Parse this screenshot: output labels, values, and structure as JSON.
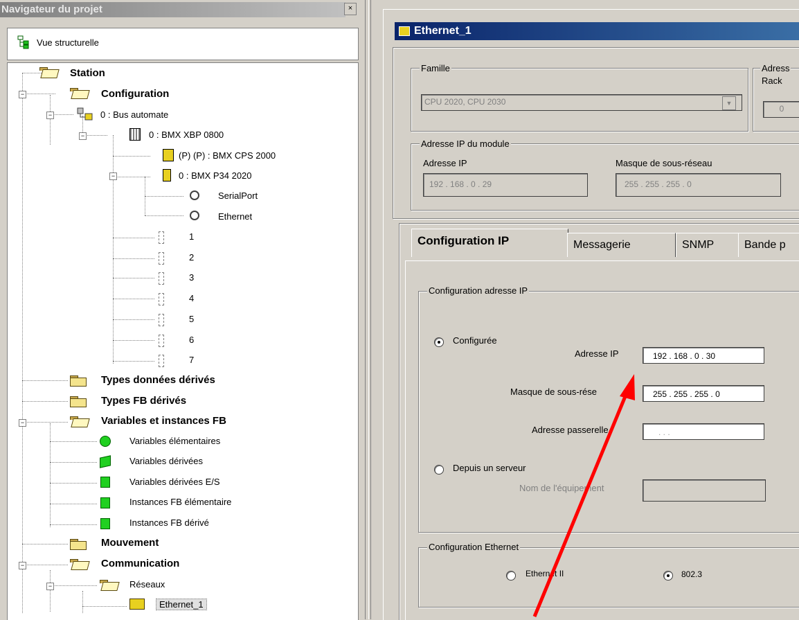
{
  "navigator": {
    "title": "Navigateur du projet",
    "close_glyph": "×",
    "view_label": "Vue structurelle",
    "tree": {
      "station": "Station",
      "configuration": "Configuration",
      "bus": "0 : Bus automate",
      "rack": "0 : BMX XBP 0800",
      "power": "(P) (P) : BMX CPS 2000",
      "cpu": "0 : BMX P34 2020",
      "serial": "SerialPort",
      "ethernet": "Ethernet",
      "slots": [
        "1",
        "2",
        "3",
        "4",
        "5",
        "6",
        "7"
      ],
      "types_donnees": "Types données dérivés",
      "types_fb": "Types FB dérivés",
      "variables_fb": "Variables et instances FB",
      "var_elem": "Variables élémentaires",
      "var_derivees": "Variables dérivées",
      "var_derivees_es": "Variables dérivées E/S",
      "inst_fb_elem": "Instances FB élémentaire",
      "inst_fb_derive": "Instances FB dérivé",
      "mouvement": "Mouvement",
      "communication": "Communication",
      "reseaux": "Réseaux",
      "ethernet_1": "Ethernet_1"
    }
  },
  "window": {
    "title": "Ethernet_1",
    "famille": {
      "legend": "Famille",
      "value": "CPU 2020, CPU 2030",
      "dropdown_glyph": "▼"
    },
    "adresse_partial": {
      "legend": "Adress",
      "rack_label": "Rack",
      "rack_value": "0"
    },
    "ip_module": {
      "legend": "Adresse IP du module",
      "ip_label": "Adresse IP",
      "ip_value": "192 . 168 . 0 . 29",
      "mask_label": "Masque de sous-réseau",
      "mask_value": "255 . 255 . 255 . 0"
    },
    "tabs": [
      "Configuration IP",
      "Messagerie",
      "SNMP",
      "Bande p"
    ],
    "config_ip": {
      "legend": "Configuration adresse IP",
      "configured_label": "Configurée",
      "ip_label": "Adresse IP",
      "ip_value": "192 . 168 .  0  . 30",
      "mask_label": "Masque de sous-rése",
      "mask_value": "255 . 255 . 255 .  0",
      "gateway_label": "Adresse passerelle",
      "gateway_value": ".      .      .",
      "server_label": "Depuis un serveur",
      "device_name_label": "Nom de l'équipement",
      "configured_selected": true
    },
    "config_ethernet": {
      "legend": "Configuration Ethernet",
      "eth2_label": "Ethernet II",
      "e8023_label": "802.3",
      "selected": "802.3"
    }
  },
  "colors": {
    "title_active": "#0a246a",
    "arrow": "#ff0000",
    "panel": "#d4d0c8"
  }
}
